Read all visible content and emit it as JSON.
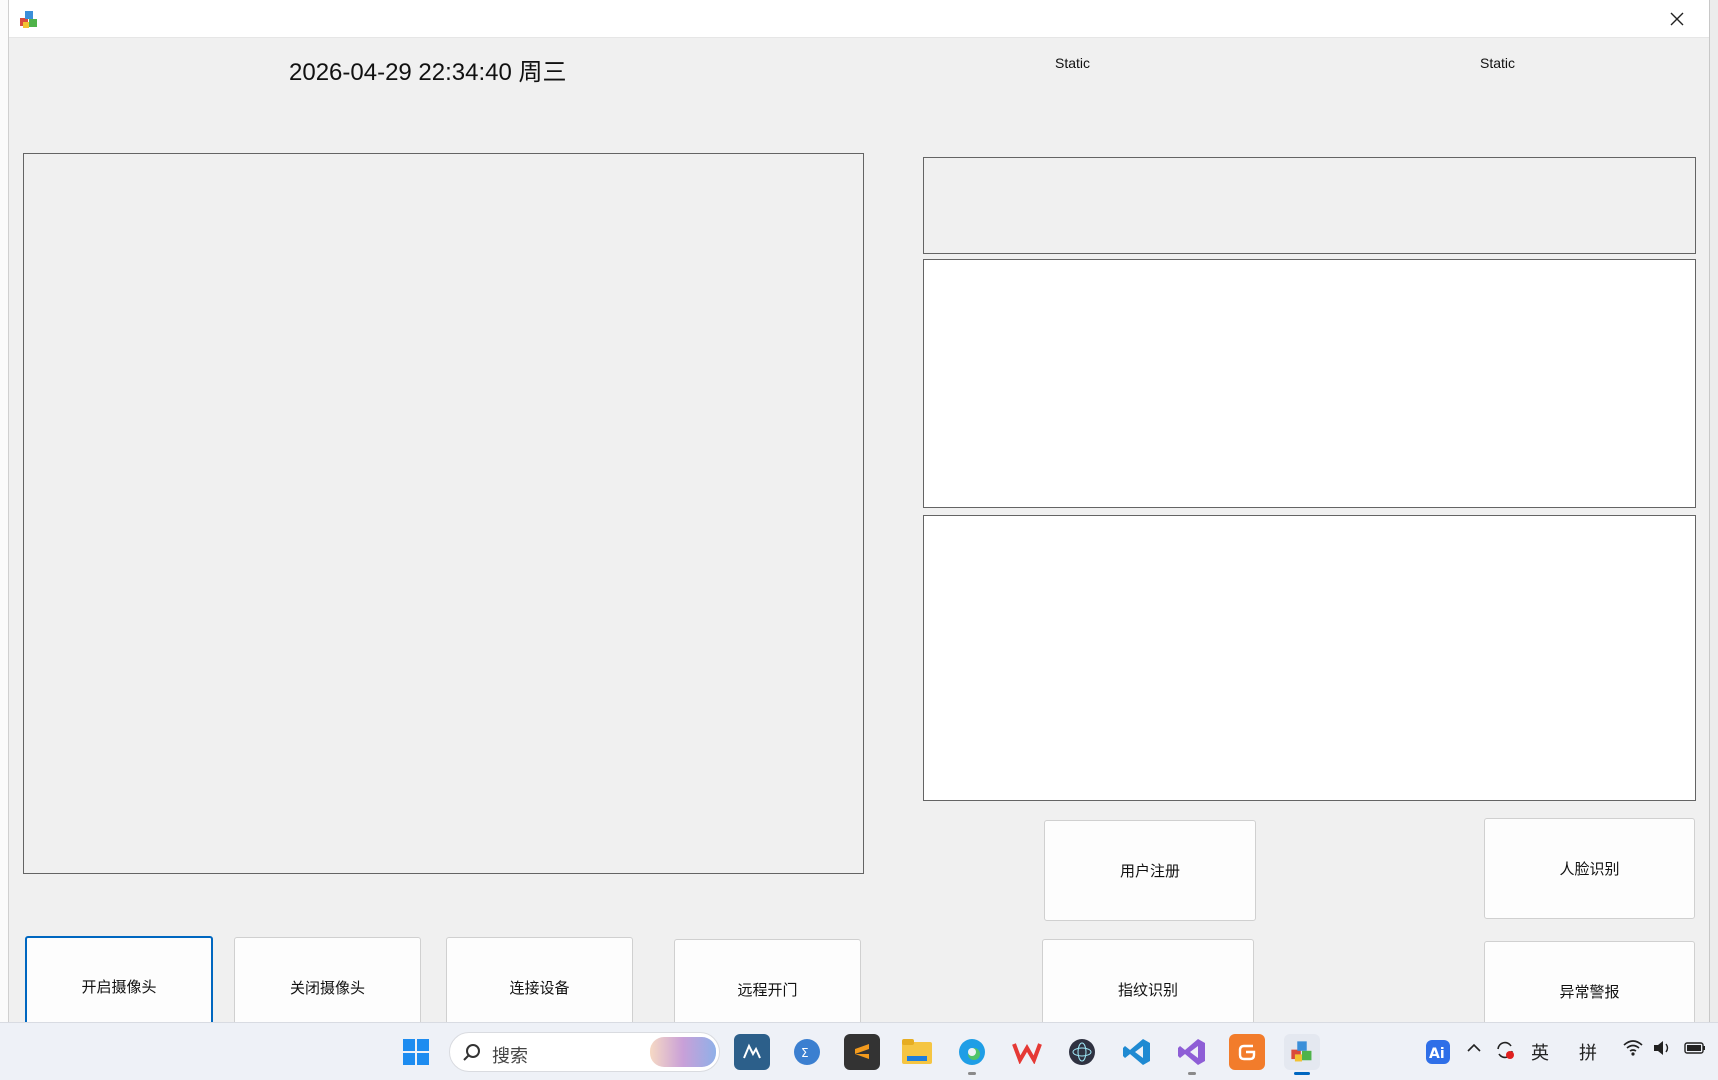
{
  "window": {
    "datetime": "2026-04-29 22:34:40 周三",
    "static_label_1": "Static",
    "static_label_2": "Static"
  },
  "buttons": {
    "open_camera": "开启摄像头",
    "close_camera": "关闭摄像头",
    "connect_device": "连接设备",
    "remote_open_door": "远程开门",
    "user_register": "用户注册",
    "face_recognition": "人脸识别",
    "fingerprint_recognition": "指纹识别",
    "abnormal_alarm": "异常警报"
  },
  "taskbar": {
    "search_placeholder": "搜索",
    "tray_input_en": "英",
    "tray_input_pinyin": "拼",
    "apps": [
      "start",
      "search",
      "mysql-workbench",
      "navicat",
      "sublime-text",
      "file-explorer",
      "edge",
      "wps",
      "electron",
      "vscode",
      "visual-studio",
      "gitee",
      "current-app"
    ]
  },
  "colors": {
    "window_bg": "#f0f0f0",
    "accent": "#0067c0",
    "panel_border": "#646464"
  }
}
